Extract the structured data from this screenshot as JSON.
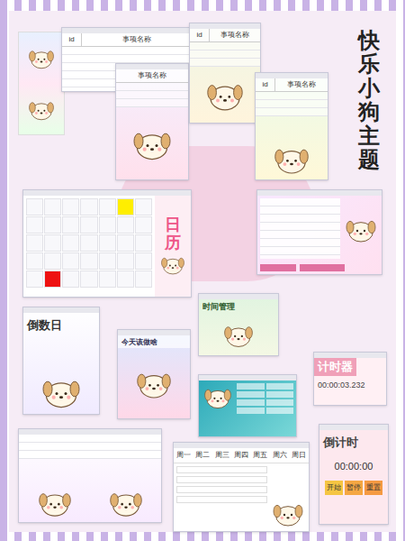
{
  "title": "快乐小狗主题",
  "todo_windows": [
    {
      "columns": [
        "id",
        "事项名称"
      ]
    },
    {
      "columns": [
        "事项名称"
      ]
    },
    {
      "columns": [
        "id",
        "事项名称"
      ]
    },
    {
      "columns": [
        "id",
        "事项名称"
      ]
    }
  ],
  "calendar": {
    "label": "日历",
    "cells": [
      {
        "marked": false
      },
      {
        "marked": false
      },
      {
        "marked": false
      },
      {
        "marked": false
      },
      {
        "marked": false
      },
      {
        "marked": true,
        "color": "#ffee00"
      },
      {
        "marked": false
      },
      {
        "marked": false
      },
      {
        "marked": false
      },
      {
        "marked": false
      },
      {
        "marked": false
      },
      {
        "marked": false
      },
      {
        "marked": false
      },
      {
        "marked": false
      },
      {
        "marked": false
      },
      {
        "marked": false
      },
      {
        "marked": false
      },
      {
        "marked": false
      },
      {
        "marked": false
      },
      {
        "marked": false
      },
      {
        "marked": false
      },
      {
        "marked": false
      },
      {
        "marked": false
      },
      {
        "marked": false
      },
      {
        "marked": false
      },
      {
        "marked": false
      },
      {
        "marked": false
      },
      {
        "marked": false
      },
      {
        "marked": false
      },
      {
        "marked": true,
        "color": "#ee1111"
      },
      {
        "marked": false
      },
      {
        "marked": false
      },
      {
        "marked": false
      },
      {
        "marked": false
      },
      {
        "marked": false
      }
    ]
  },
  "countdown_days": {
    "title": "倒数日"
  },
  "today": {
    "title": "今天该做啥"
  },
  "time_manage": {
    "title": "时间管理"
  },
  "stopwatch": {
    "title": "计时器",
    "time": "00:00:03.232"
  },
  "timer": {
    "title": "倒计时",
    "time": "00:00:00",
    "buttons": [
      {
        "label": "开始",
        "color": "#f5c542"
      },
      {
        "label": "暂停",
        "color": "#f5a742"
      },
      {
        "label": "重置",
        "color": "#f59a42"
      }
    ]
  },
  "weekly": {
    "days": [
      "周一",
      "周二",
      "周三",
      "周四",
      "周五",
      "周六",
      "周日"
    ]
  }
}
